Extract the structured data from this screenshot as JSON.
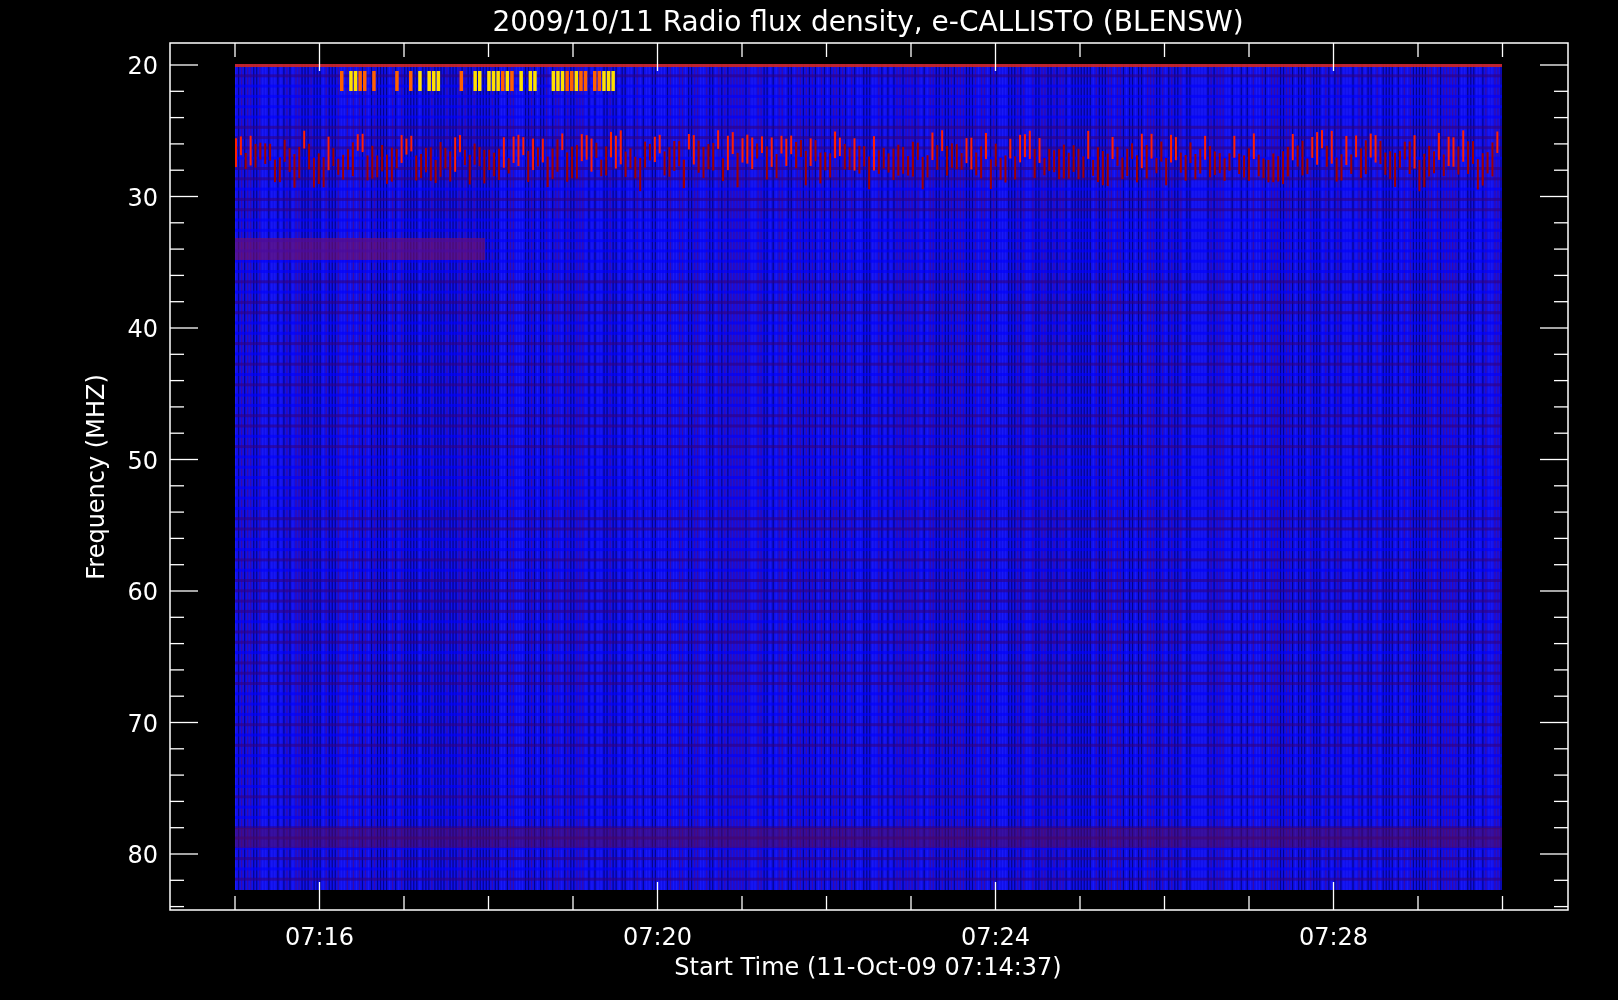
{
  "title": "2009/10/11  Radio flux density, e-CALLISTO (BLENSW)",
  "y_axis": {
    "label": "Frequency (MHZ)",
    "ticks": [
      "20",
      "30",
      "40",
      "50",
      "60",
      "70",
      "80"
    ]
  },
  "x_axis": {
    "label": "Start Time (11-Oct-09 07:14:37)",
    "ticks": [
      "07:16",
      "07:20",
      "07:24",
      "07:28"
    ]
  }
}
